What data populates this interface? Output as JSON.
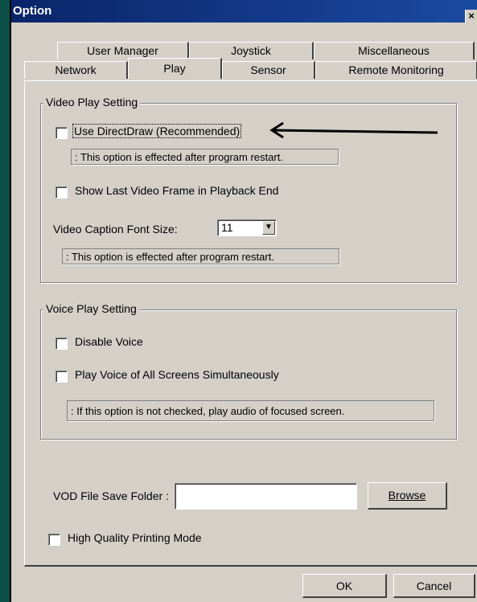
{
  "window": {
    "title": "Option",
    "close_glyph": "×"
  },
  "tabs": {
    "row1": [
      "User Manager",
      "Joystick",
      "Miscellaneous"
    ],
    "row2": [
      "Network",
      "Play",
      "Sensor",
      "Remote Monitoring"
    ],
    "active": "Play"
  },
  "video": {
    "group_label": "Video Play Setting",
    "use_directdraw_label": "Use DirectDraw (Recommended)",
    "use_directdraw_checked": false,
    "note1": ": This option is effected after program restart.",
    "show_last_frame_label": "Show Last Video Frame in Playback End",
    "show_last_frame_checked": false,
    "caption_font_label": "Video Caption Font Size:",
    "caption_font_value": "11",
    "note2": ": This option is effected after program restart."
  },
  "voice": {
    "group_label": "Voice Play Setting",
    "disable_voice_label": "Disable Voice",
    "disable_voice_checked": false,
    "play_all_label": "Play Voice of All Screens Simultaneously",
    "play_all_checked": false,
    "note": ": If this option is not checked, play audio of focused screen."
  },
  "vod": {
    "label": "VOD File Save Folder :",
    "value": "",
    "browse_label": "Browse"
  },
  "printing": {
    "label": "High Quality Printing Mode",
    "checked": false
  },
  "buttons": {
    "ok": "OK",
    "cancel": "Cancel"
  },
  "colors": {
    "titlebar": "#0a246a",
    "face": "#d4d0c8",
    "left_bar": "#0c4f47"
  }
}
